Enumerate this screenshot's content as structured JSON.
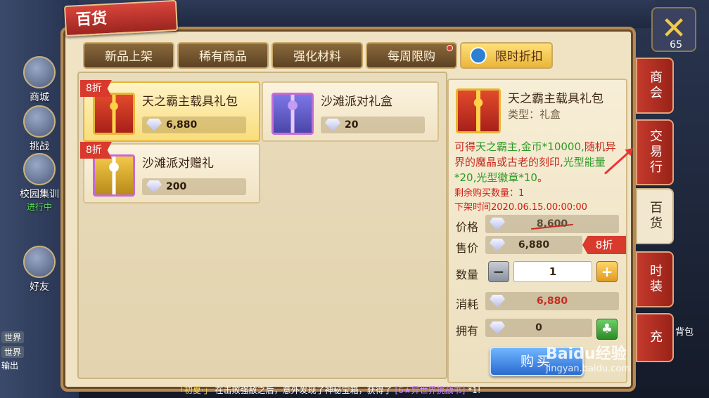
{
  "hud": {
    "shop_label": "商城",
    "battle_label": "挑战",
    "campus_label": "校园集训",
    "campus_status": "进行中",
    "friends_label": "好友",
    "level": "65",
    "chat_tag_1": "世界",
    "chat_tag_2": "世界",
    "output_label": "输出",
    "backpack_label": "背包",
    "ticker_name": "「初夏·」",
    "ticker_text": "在击败强敌之后，意外发现了神秘宝箱，获得了",
    "ticker_item": "[6★异世界挑战书]",
    "ticker_suffix": "*1!"
  },
  "panel": {
    "title": "百货",
    "tabs": [
      {
        "label": "新品上架"
      },
      {
        "label": "稀有商品"
      },
      {
        "label": "强化材料"
      },
      {
        "label": "每周限购"
      },
      {
        "label": "限时折扣"
      }
    ]
  },
  "items": [
    {
      "name": "天之霸主载具礼包",
      "price": "6,880",
      "badge": "8折"
    },
    {
      "name": "沙滩派对礼盒",
      "price": "20",
      "badge": ""
    },
    {
      "name": "沙滩派对赠礼",
      "price": "200",
      "badge": "8折"
    }
  ],
  "detail": {
    "name": "天之霸主载具礼包",
    "type": "类型：礼盒",
    "desc_1": "可得",
    "desc_2": "天之霸主,金币*10000,",
    "desc_3": "随机异界的魔晶或古老的刻印,",
    "desc_4": "光型能量*20,光型徽章*10",
    "desc_5": "。",
    "remaining": "剩余购买数量：1",
    "off_time": "下架时间2020.06.15.00:00:00",
    "price_label": "价格",
    "price_value": "8,600",
    "sale_label": "售价",
    "sale_value": "6,880",
    "discount": "8折",
    "qty_label": "数量",
    "qty_value": "1",
    "cost_label": "消耗",
    "cost_value": "6,880",
    "own_label": "拥有",
    "own_value": "0",
    "buy_label": "购买"
  },
  "side_tabs": [
    "商会",
    "交易行",
    "百货",
    "时装",
    "充"
  ],
  "watermark": {
    "brand": "Baidu经验",
    "url": "jingyan.baidu.com"
  }
}
